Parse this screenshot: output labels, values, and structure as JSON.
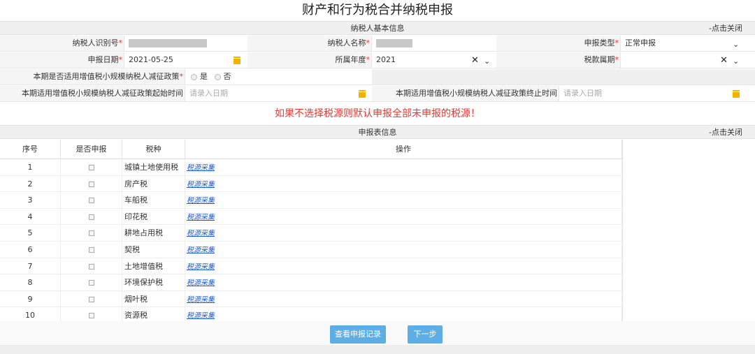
{
  "page_title": "财产和行为税合并纳税申报",
  "basic_info": {
    "section_title": "纳税人基本信息",
    "close_link": "-点击关闭",
    "taxpayer_id_label": "纳税人识别号",
    "taxpayer_name_label": "纳税人名称",
    "declare_type_label": "申报类型",
    "declare_type_value": "正常申报",
    "declare_date_label": "申报日期",
    "declare_date_value": "2021-05-25",
    "year_label": "所属年度",
    "year_value": "2021",
    "period_label": "税款属期",
    "policy_label": "本期是否适用增值税小规模纳税人减征政策",
    "policy_yes": "是",
    "policy_no": "否",
    "start_label": "本期适用增值税小规模纳税人减征政策起始时间",
    "start_placeholder": "请录入日期",
    "end_label": "本期适用增值税小规模纳税人减征政策终止时间",
    "end_placeholder": "请录入日期",
    "required_mark": "*"
  },
  "warning_text": "如果不选择税源则默认申报全部未申报的税源！",
  "declare_info": {
    "section_title": "申报表信息",
    "close_link": "-点击关闭",
    "columns": [
      "序号",
      "是否申报",
      "税种",
      "操作"
    ],
    "rows": [
      {
        "seq": "1",
        "tax": "城镇土地使用税",
        "op": "税源采集"
      },
      {
        "seq": "2",
        "tax": "房产税",
        "op": "税源采集"
      },
      {
        "seq": "3",
        "tax": "车船税",
        "op": "税源采集"
      },
      {
        "seq": "4",
        "tax": "印花税",
        "op": "税源采集"
      },
      {
        "seq": "5",
        "tax": "耕地占用税",
        "op": "税源采集"
      },
      {
        "seq": "6",
        "tax": "契税",
        "op": "税源采集"
      },
      {
        "seq": "7",
        "tax": "土地增值税",
        "op": "税源采集"
      },
      {
        "seq": "8",
        "tax": "环境保护税",
        "op": "税源采集"
      },
      {
        "seq": "9",
        "tax": "烟叶税",
        "op": "税源采集"
      },
      {
        "seq": "10",
        "tax": "资源税",
        "op": "税源采集"
      }
    ]
  },
  "buttons": {
    "view_records": "查看申报记录",
    "next_step": "下一步"
  },
  "colors": {
    "required": "#e53935",
    "button": "#5eaee6",
    "link": "#1a57c8",
    "calendar_icon": "#f0b400"
  }
}
